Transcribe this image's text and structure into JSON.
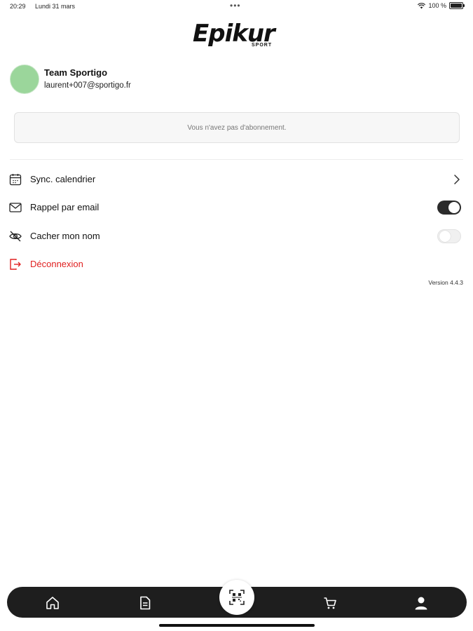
{
  "status_bar": {
    "time": "20:29",
    "date": "Lundi 31 mars",
    "battery": "100 %"
  },
  "logo": {
    "main": "Epikur",
    "sub": "SPORT"
  },
  "profile": {
    "name": "Team Sportigo",
    "email": "laurent+007@sportigo.fr"
  },
  "subscription": {
    "message": "Vous n'avez pas d'abonnement."
  },
  "menu": {
    "sync_calendar": {
      "label": "Sync. calendrier",
      "icon": "calendar-icon"
    },
    "email_reminder": {
      "label": "Rappel par email",
      "icon": "mail-icon",
      "enabled": true
    },
    "hide_name": {
      "label": "Cacher mon nom",
      "icon": "eye-off-icon",
      "enabled": false
    },
    "logout": {
      "label": "Déconnexion",
      "icon": "logout-icon"
    }
  },
  "version": "Version 4.4.3",
  "tabs": [
    "home-icon",
    "document-icon",
    "qr-scan-icon",
    "cart-icon",
    "user-icon"
  ],
  "colors": {
    "accent_red": "#e02020",
    "tabbar_bg": "#1e1e1e",
    "avatar_green": "#9bd69b"
  }
}
